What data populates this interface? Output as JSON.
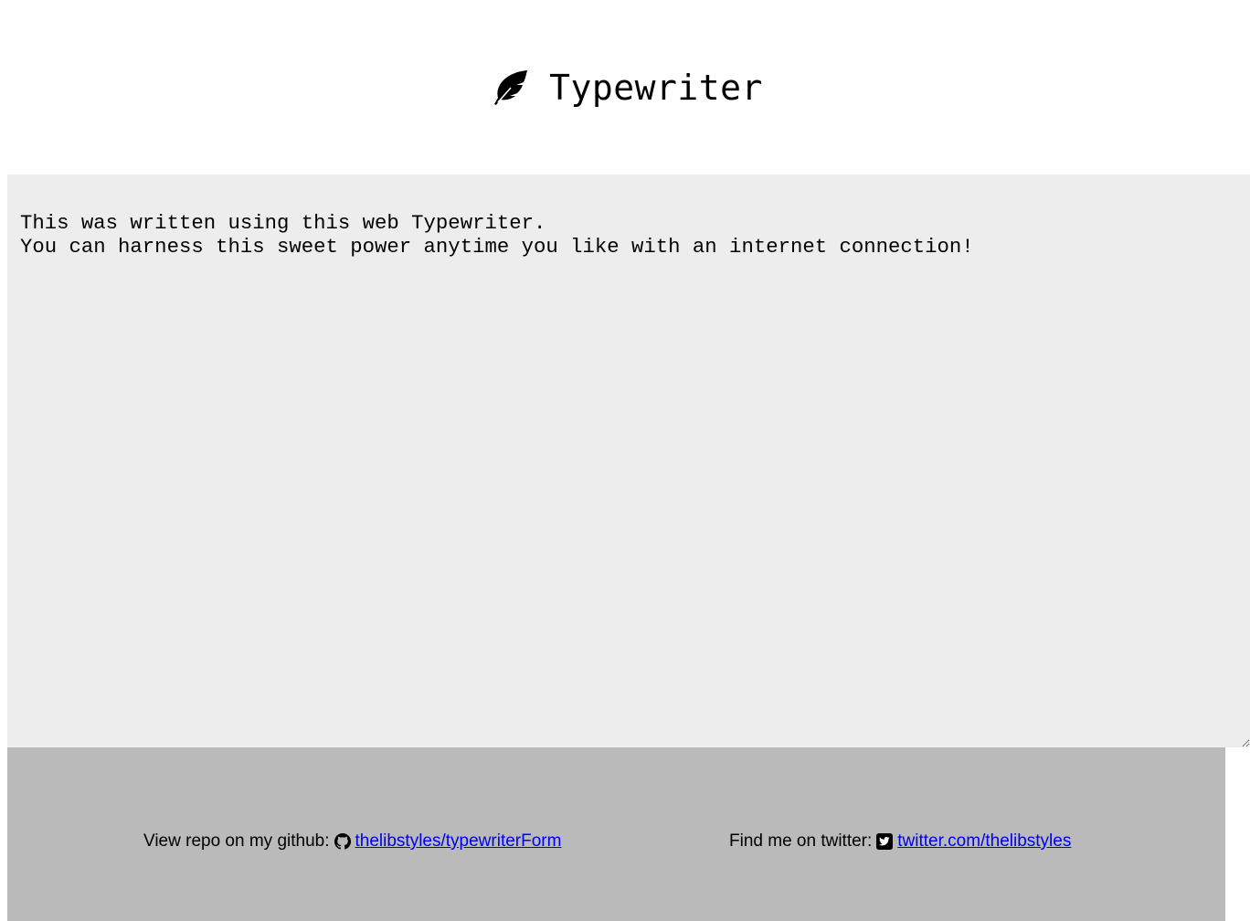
{
  "header": {
    "title": "Typewriter",
    "icon": "feather-icon"
  },
  "editor": {
    "value": "This was written using this web Typewriter.\nYou can harness this sweet power anytime you like with an internet connection!",
    "background": "#ededed"
  },
  "footer": {
    "background": "#bababa",
    "github": {
      "label": "View repo on my github:",
      "icon": "github-icon",
      "link_text": "thelibstyles/typewriterForm"
    },
    "twitter": {
      "label": "Find me on twitter:",
      "icon": "twitter-icon",
      "link_text": "twitter.com/thelibstyles"
    },
    "link_color": "#0000ee"
  }
}
